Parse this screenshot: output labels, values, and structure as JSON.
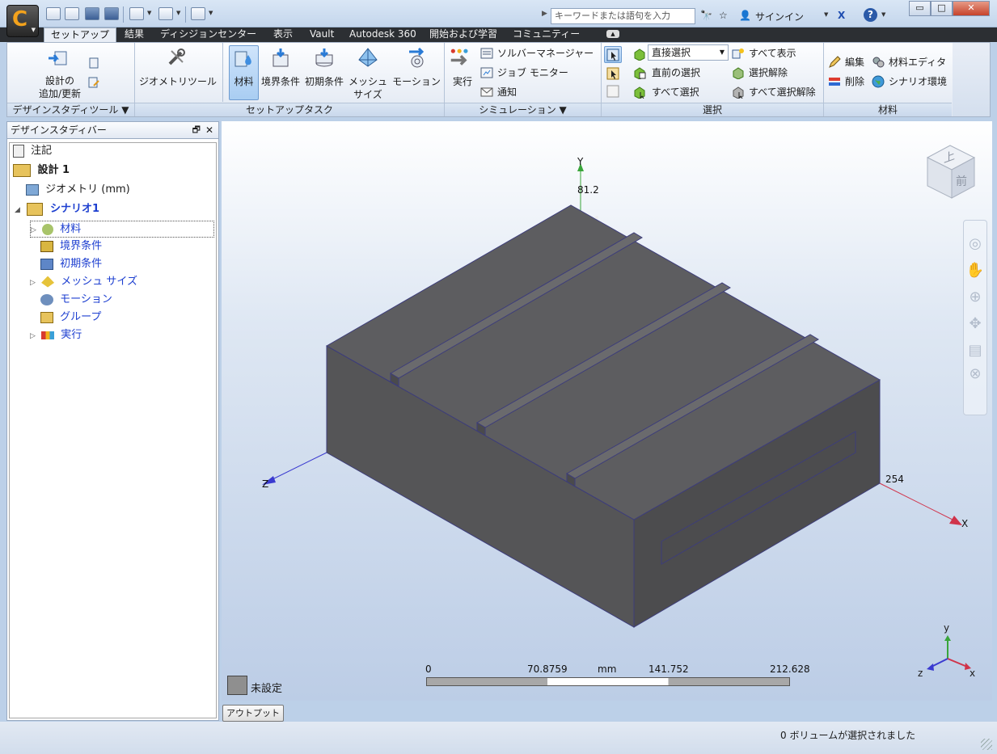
{
  "app": {
    "logo_letter": "C"
  },
  "search": {
    "placeholder": "キーワードまたは語句を入力"
  },
  "titlebar": {
    "signin": "サインイン"
  },
  "tabs": [
    "セットアップ",
    "結果",
    "ディシジョンセンター",
    "表示",
    "Vault",
    "Autodesk 360",
    "開始および学習",
    "コミュニティー"
  ],
  "ribbon": {
    "design_study": {
      "add_update": "設計の\n追加/更新",
      "footer": "デザインスタディツール"
    },
    "setup": {
      "geometry_tool": "ジオメトリツール",
      "material": "材料",
      "boundary": "境界条件",
      "initial": "初期条件",
      "mesh": "メッシュ\nサイズ",
      "motion": "モーション",
      "footer": "セットアップタスク"
    },
    "simulation": {
      "run": "実行",
      "solver_manager": "ソルバーマネージャー",
      "job_monitor": "ジョブ モニター",
      "notify": "通知",
      "footer": "シミュレーション"
    },
    "selection": {
      "mode_value": "直接選択",
      "previous": "直前の選択",
      "select_all": "すべて選択",
      "show_all": "すべて表示",
      "deselect": "選択解除",
      "deselect_all": "すべて選択解除",
      "footer": "選択"
    },
    "materials": {
      "edit": "編集",
      "delete": "削除",
      "editor": "材料エディタ",
      "scenario_env": "シナリオ環境",
      "footer": "材料"
    }
  },
  "browser": {
    "title": "デザインスタディバー",
    "tree": [
      {
        "label": "注記",
        "level": 0
      },
      {
        "label": "設計 1",
        "level": 0
      },
      {
        "label": "ジオメトリ (mm)",
        "level": 1
      },
      {
        "label": "シナリオ1",
        "level": 1
      },
      {
        "label": "材料",
        "level": 2
      },
      {
        "label": "境界条件",
        "level": 2
      },
      {
        "label": "初期条件",
        "level": 2
      },
      {
        "label": "メッシュ サイズ",
        "level": 2
      },
      {
        "label": "モーション",
        "level": 2
      },
      {
        "label": "グループ",
        "level": 2
      },
      {
        "label": "実行",
        "level": 2
      }
    ]
  },
  "viewport": {
    "axis_y": "Y",
    "axis_z": "Z",
    "axis_x": "X",
    "dim_y": "81.2",
    "dim_x": "254",
    "viewcube_top": "上",
    "viewcube_front": "前",
    "scale": {
      "v0": "0",
      "v1": "70.8759",
      "unit": "mm",
      "v2": "141.752",
      "v3": "212.628"
    },
    "legend_label": "未設定",
    "triad": {
      "x": "x",
      "y": "y",
      "z": "z"
    }
  },
  "output_bar": "アウトプットバー",
  "status_text": "0 ボリュームが選択されました",
  "colors": {
    "accent": "#f3a21c",
    "model": "#5a5a5c",
    "link": "#1d3fd0"
  }
}
